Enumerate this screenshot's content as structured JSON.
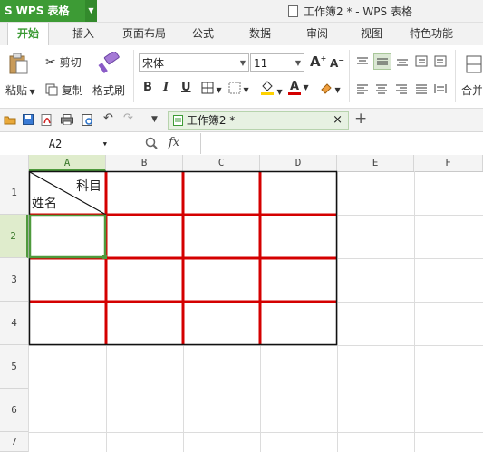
{
  "app": {
    "name": "WPS 表格",
    "logo": "S"
  },
  "window_title": "工作簿2 * - WPS 表格",
  "tabs": [
    "开始",
    "插入",
    "页面布局",
    "公式",
    "数据",
    "审阅",
    "视图",
    "特色功能"
  ],
  "ribbon": {
    "paste": "粘贴",
    "cut": "剪切",
    "copy": "复制",
    "format_painter": "格式刷",
    "font_name": "宋体",
    "font_size": "11",
    "grow_font": "A",
    "shrink_font": "A",
    "bold": "B",
    "italic": "I",
    "underline": "U",
    "font_color_letter": "A",
    "merge": "合并"
  },
  "doc_tab": {
    "label": "工作簿2 *",
    "close": "×",
    "new": "+"
  },
  "formula_bar": {
    "name_box": "A2",
    "fx": "fx",
    "value": ""
  },
  "columns": [
    "A",
    "B",
    "C",
    "D",
    "E",
    "F"
  ],
  "rows": [
    "1",
    "2",
    "3",
    "4",
    "5",
    "6",
    "7"
  ],
  "cell_a1": {
    "top_right": "科目",
    "bottom_left": "姓名"
  },
  "colors": {
    "brand_green": "#3d9b35",
    "table_border_red": "#d40000",
    "selection": "#4e9a3c"
  },
  "icons": [
    "paste-icon",
    "scissors-icon",
    "copy-icon",
    "format-painter-icon",
    "open-folder-icon",
    "save-icon",
    "pdf-icon",
    "print-icon",
    "print-preview-icon",
    "undo-icon",
    "redo-icon",
    "zoom-icon"
  ]
}
